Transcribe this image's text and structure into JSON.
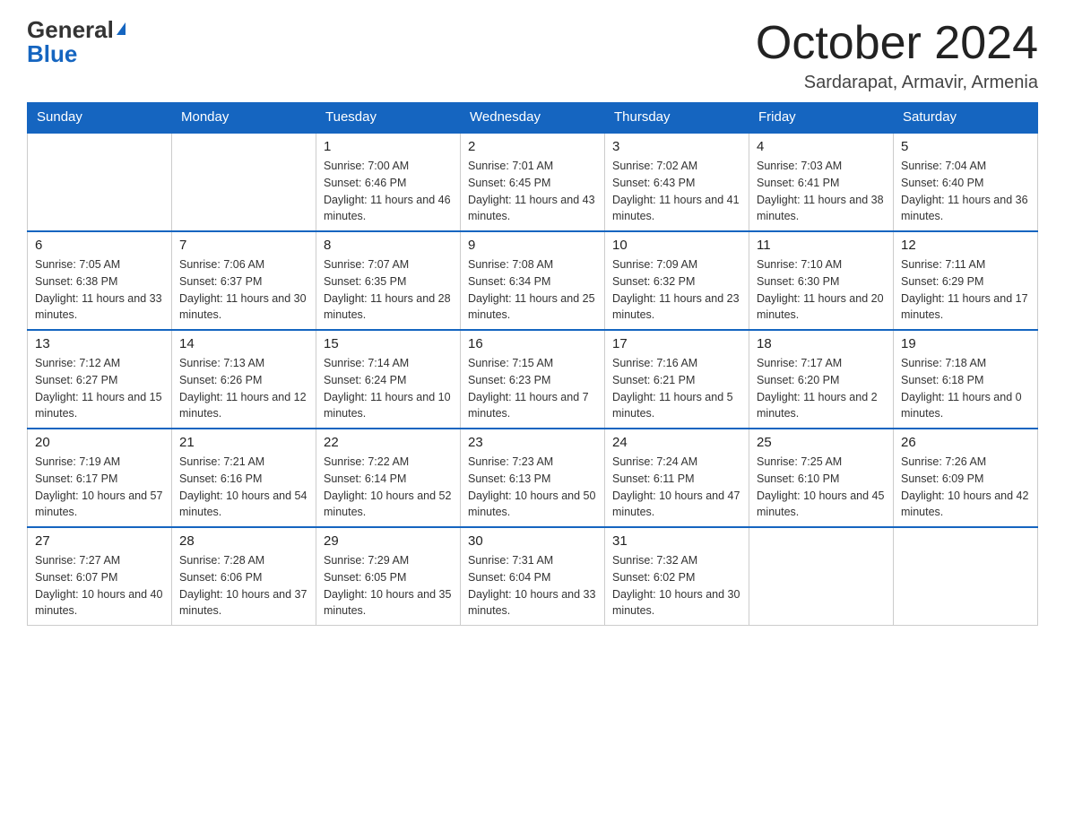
{
  "header": {
    "logo_general": "General",
    "logo_blue": "Blue",
    "month_title": "October 2024",
    "location": "Sardarapat, Armavir, Armenia"
  },
  "days_of_week": [
    "Sunday",
    "Monday",
    "Tuesday",
    "Wednesday",
    "Thursday",
    "Friday",
    "Saturday"
  ],
  "weeks": [
    [
      {
        "day": "",
        "sunrise": "",
        "sunset": "",
        "daylight": ""
      },
      {
        "day": "",
        "sunrise": "",
        "sunset": "",
        "daylight": ""
      },
      {
        "day": "1",
        "sunrise": "Sunrise: 7:00 AM",
        "sunset": "Sunset: 6:46 PM",
        "daylight": "Daylight: 11 hours and 46 minutes."
      },
      {
        "day": "2",
        "sunrise": "Sunrise: 7:01 AM",
        "sunset": "Sunset: 6:45 PM",
        "daylight": "Daylight: 11 hours and 43 minutes."
      },
      {
        "day": "3",
        "sunrise": "Sunrise: 7:02 AM",
        "sunset": "Sunset: 6:43 PM",
        "daylight": "Daylight: 11 hours and 41 minutes."
      },
      {
        "day": "4",
        "sunrise": "Sunrise: 7:03 AM",
        "sunset": "Sunset: 6:41 PM",
        "daylight": "Daylight: 11 hours and 38 minutes."
      },
      {
        "day": "5",
        "sunrise": "Sunrise: 7:04 AM",
        "sunset": "Sunset: 6:40 PM",
        "daylight": "Daylight: 11 hours and 36 minutes."
      }
    ],
    [
      {
        "day": "6",
        "sunrise": "Sunrise: 7:05 AM",
        "sunset": "Sunset: 6:38 PM",
        "daylight": "Daylight: 11 hours and 33 minutes."
      },
      {
        "day": "7",
        "sunrise": "Sunrise: 7:06 AM",
        "sunset": "Sunset: 6:37 PM",
        "daylight": "Daylight: 11 hours and 30 minutes."
      },
      {
        "day": "8",
        "sunrise": "Sunrise: 7:07 AM",
        "sunset": "Sunset: 6:35 PM",
        "daylight": "Daylight: 11 hours and 28 minutes."
      },
      {
        "day": "9",
        "sunrise": "Sunrise: 7:08 AM",
        "sunset": "Sunset: 6:34 PM",
        "daylight": "Daylight: 11 hours and 25 minutes."
      },
      {
        "day": "10",
        "sunrise": "Sunrise: 7:09 AM",
        "sunset": "Sunset: 6:32 PM",
        "daylight": "Daylight: 11 hours and 23 minutes."
      },
      {
        "day": "11",
        "sunrise": "Sunrise: 7:10 AM",
        "sunset": "Sunset: 6:30 PM",
        "daylight": "Daylight: 11 hours and 20 minutes."
      },
      {
        "day": "12",
        "sunrise": "Sunrise: 7:11 AM",
        "sunset": "Sunset: 6:29 PM",
        "daylight": "Daylight: 11 hours and 17 minutes."
      }
    ],
    [
      {
        "day": "13",
        "sunrise": "Sunrise: 7:12 AM",
        "sunset": "Sunset: 6:27 PM",
        "daylight": "Daylight: 11 hours and 15 minutes."
      },
      {
        "day": "14",
        "sunrise": "Sunrise: 7:13 AM",
        "sunset": "Sunset: 6:26 PM",
        "daylight": "Daylight: 11 hours and 12 minutes."
      },
      {
        "day": "15",
        "sunrise": "Sunrise: 7:14 AM",
        "sunset": "Sunset: 6:24 PM",
        "daylight": "Daylight: 11 hours and 10 minutes."
      },
      {
        "day": "16",
        "sunrise": "Sunrise: 7:15 AM",
        "sunset": "Sunset: 6:23 PM",
        "daylight": "Daylight: 11 hours and 7 minutes."
      },
      {
        "day": "17",
        "sunrise": "Sunrise: 7:16 AM",
        "sunset": "Sunset: 6:21 PM",
        "daylight": "Daylight: 11 hours and 5 minutes."
      },
      {
        "day": "18",
        "sunrise": "Sunrise: 7:17 AM",
        "sunset": "Sunset: 6:20 PM",
        "daylight": "Daylight: 11 hours and 2 minutes."
      },
      {
        "day": "19",
        "sunrise": "Sunrise: 7:18 AM",
        "sunset": "Sunset: 6:18 PM",
        "daylight": "Daylight: 11 hours and 0 minutes."
      }
    ],
    [
      {
        "day": "20",
        "sunrise": "Sunrise: 7:19 AM",
        "sunset": "Sunset: 6:17 PM",
        "daylight": "Daylight: 10 hours and 57 minutes."
      },
      {
        "day": "21",
        "sunrise": "Sunrise: 7:21 AM",
        "sunset": "Sunset: 6:16 PM",
        "daylight": "Daylight: 10 hours and 54 minutes."
      },
      {
        "day": "22",
        "sunrise": "Sunrise: 7:22 AM",
        "sunset": "Sunset: 6:14 PM",
        "daylight": "Daylight: 10 hours and 52 minutes."
      },
      {
        "day": "23",
        "sunrise": "Sunrise: 7:23 AM",
        "sunset": "Sunset: 6:13 PM",
        "daylight": "Daylight: 10 hours and 50 minutes."
      },
      {
        "day": "24",
        "sunrise": "Sunrise: 7:24 AM",
        "sunset": "Sunset: 6:11 PM",
        "daylight": "Daylight: 10 hours and 47 minutes."
      },
      {
        "day": "25",
        "sunrise": "Sunrise: 7:25 AM",
        "sunset": "Sunset: 6:10 PM",
        "daylight": "Daylight: 10 hours and 45 minutes."
      },
      {
        "day": "26",
        "sunrise": "Sunrise: 7:26 AM",
        "sunset": "Sunset: 6:09 PM",
        "daylight": "Daylight: 10 hours and 42 minutes."
      }
    ],
    [
      {
        "day": "27",
        "sunrise": "Sunrise: 7:27 AM",
        "sunset": "Sunset: 6:07 PM",
        "daylight": "Daylight: 10 hours and 40 minutes."
      },
      {
        "day": "28",
        "sunrise": "Sunrise: 7:28 AM",
        "sunset": "Sunset: 6:06 PM",
        "daylight": "Daylight: 10 hours and 37 minutes."
      },
      {
        "day": "29",
        "sunrise": "Sunrise: 7:29 AM",
        "sunset": "Sunset: 6:05 PM",
        "daylight": "Daylight: 10 hours and 35 minutes."
      },
      {
        "day": "30",
        "sunrise": "Sunrise: 7:31 AM",
        "sunset": "Sunset: 6:04 PM",
        "daylight": "Daylight: 10 hours and 33 minutes."
      },
      {
        "day": "31",
        "sunrise": "Sunrise: 7:32 AM",
        "sunset": "Sunset: 6:02 PM",
        "daylight": "Daylight: 10 hours and 30 minutes."
      },
      {
        "day": "",
        "sunrise": "",
        "sunset": "",
        "daylight": ""
      },
      {
        "day": "",
        "sunrise": "",
        "sunset": "",
        "daylight": ""
      }
    ]
  ]
}
